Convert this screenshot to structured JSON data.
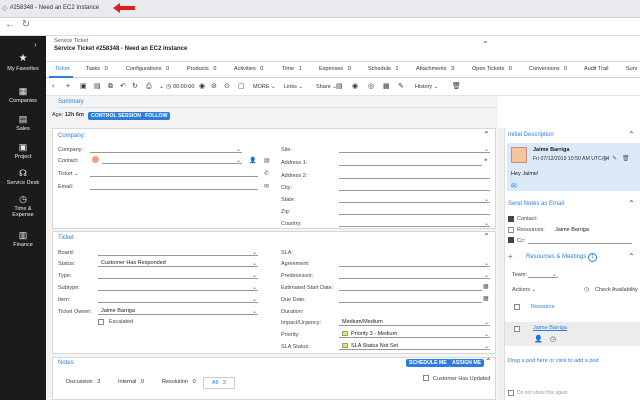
{
  "browser": {
    "tab_title": "#258348 - Need an EC2 Instance"
  },
  "sidebar": {
    "items": [
      {
        "label": "My Favorites",
        "icon": "star-icon"
      },
      {
        "label": "Companies",
        "icon": "building-icon"
      },
      {
        "label": "Sales",
        "icon": "briefcase-icon"
      },
      {
        "label": "Project",
        "icon": "clipboard-icon"
      },
      {
        "label": "Service Desk",
        "icon": "headset-icon"
      },
      {
        "label": "Time & Expense",
        "icon": "clock-icon"
      },
      {
        "label": "Finance",
        "icon": "finance-icon"
      }
    ]
  },
  "header": {
    "breadcrumb": "Service Ticket",
    "title": "Service Ticket #258348 - Need an EC2 Instance"
  },
  "tabs": [
    {
      "label": "Ticket",
      "count": ""
    },
    {
      "label": "Tasks",
      "count": "0"
    },
    {
      "label": "Configurations",
      "count": "0"
    },
    {
      "label": "Products",
      "count": "0"
    },
    {
      "label": "Activities",
      "count": "0"
    },
    {
      "label": "Time",
      "count": "1"
    },
    {
      "label": "Expenses",
      "count": "0"
    },
    {
      "label": "Schedule",
      "count": "1"
    },
    {
      "label": "Attachments",
      "count": "3"
    },
    {
      "label": "Open Tickets",
      "count": "0"
    },
    {
      "label": "Conversions",
      "count": "0"
    },
    {
      "label": "Audit Trail",
      "count": ""
    },
    {
      "label": "Surv",
      "count": ""
    }
  ],
  "toolbar": {
    "timer": "00:00:00",
    "more": "MORE",
    "links": "Links",
    "share": "Share",
    "history": "History"
  },
  "summary": {
    "title": "Summary",
    "age_label": "Age:",
    "age_value": "12h 6m",
    "control_session": "CONTROL SESSION",
    "follow": "FOLLOW"
  },
  "company": {
    "title": "Company:",
    "company_label": "Company:",
    "contact_label": "Contact:",
    "ticket_label": "Ticket",
    "email_label": "Email:",
    "site_label": "Site:",
    "address1_label": "Address 1:",
    "address2_label": "Address 2:",
    "city_label": "City:",
    "state_label": "State:",
    "zip_label": "Zip:",
    "country_label": "Country:"
  },
  "ticket": {
    "title": "Ticket",
    "board_label": "Board:",
    "status_label": "Status:",
    "status_value": "Customer Has Responded",
    "type_label": "Type:",
    "subtype_label": "Subtype:",
    "item_label": "Item:",
    "owner_label": "Ticket Owner:",
    "owner_value": "Jaime Barriga",
    "escalated_label": "Escalated",
    "sla_label": "SLA:",
    "agreement_label": "Agreement:",
    "predecessor_label": "Predecessor:",
    "est_start_label": "Estimated Start Date:",
    "due_label": "Due Date:",
    "duration_label": "Duration:",
    "impact_label": "Impact/Urgency:",
    "impact_value": "Medium/Medium",
    "priority_label": "Priority:",
    "priority_value": "Priority 3 - Medium",
    "sla_status_label": "SLA Status:",
    "sla_status_value": "SLA Status Not Set"
  },
  "notes": {
    "title": "Notes",
    "schedule_me": "SCHEDULE ME",
    "assign_me": "ASSIGN ME",
    "customer_updated": "Customer Has Updated",
    "tabs": [
      {
        "label": "Discussion",
        "count": "3"
      },
      {
        "label": "Internal",
        "count": "0"
      },
      {
        "label": "Resolution",
        "count": "0"
      },
      {
        "label": "All",
        "count": "3"
      }
    ]
  },
  "initial_description": {
    "title": "Initial Description",
    "author": "Jaime Barriga",
    "date": "Fri 07/12/2019 10:50 AM UTC-04",
    "body": "Hey Jaime!"
  },
  "send_notes": {
    "title": "Send Notes as Email",
    "contact": "Contact:",
    "resources": "Resources:",
    "resources_value": "Jaime Barriga",
    "cc": "Cc:"
  },
  "resources": {
    "title": "Resources & Meetings",
    "count": "1",
    "team_label": "Team:",
    "actions": "Actions",
    "check_availability": "Check Availability",
    "resource_header": "Resource",
    "resource_name": "Jaime Barriga",
    "drag_hint": "Drag a pod here or click to add a pod",
    "do_not_show": "Do not show this again"
  },
  "colors": {
    "accent": "#2b7de1",
    "sidebar": "#1b1b1b",
    "note_bg": "#dbe9f9"
  }
}
